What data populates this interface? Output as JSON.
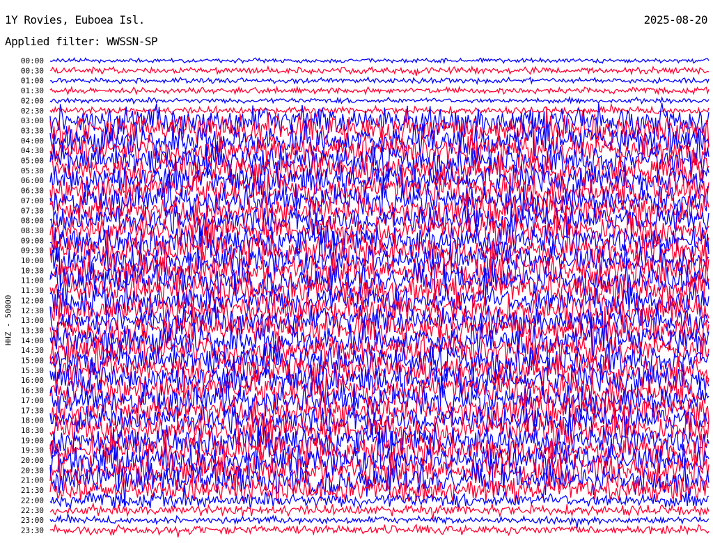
{
  "header": {
    "title": "1Y Rovies, Euboea Isl.",
    "filter": "Applied filter: WWSSN-SP",
    "date": "2025-08-20"
  },
  "chart_data": {
    "type": "line",
    "title": "1Y Rovies, Euboea Isl.",
    "subtitle": "Applied filter: WWSSN-SP",
    "date": "2025-08-20",
    "ylabel": "HHZ - 50000",
    "xlabel": "",
    "row_labels": [
      "00:00",
      "00:30",
      "01:00",
      "01:30",
      "02:00",
      "02:30",
      "03:00",
      "03:30",
      "04:00",
      "04:30",
      "05:00",
      "05:30",
      "06:00",
      "06:30",
      "07:00",
      "07:30",
      "08:00",
      "08:30",
      "09:00",
      "09:30",
      "10:00",
      "10:30",
      "11:00",
      "11:30",
      "12:00",
      "12:30",
      "13:00",
      "13:30",
      "14:00",
      "14:30",
      "15:00",
      "15:30",
      "16:00",
      "16:30",
      "17:00",
      "17:30",
      "18:00",
      "18:30",
      "19:00",
      "19:30",
      "20:00",
      "20:30",
      "21:00",
      "21:30",
      "22:00",
      "22:30",
      "23:00",
      "23:30"
    ],
    "row_amplitude_level": [
      0.15,
      0.22,
      0.18,
      0.2,
      0.18,
      0.25,
      1.0,
      1.0,
      1.0,
      1.0,
      1.0,
      1.0,
      1.0,
      1.0,
      1.0,
      1.0,
      1.0,
      1.0,
      1.0,
      1.0,
      1.0,
      1.0,
      1.0,
      1.0,
      1.0,
      1.0,
      1.0,
      1.0,
      1.0,
      1.0,
      1.0,
      1.0,
      1.0,
      1.0,
      1.0,
      1.0,
      1.0,
      1.0,
      1.0,
      1.0,
      1.0,
      1.0,
      1.0,
      0.8,
      0.5,
      0.35,
      0.25,
      0.3
    ],
    "trace_colors": [
      "#0000ff",
      "#ff0030"
    ],
    "x_range_minutes": [
      0,
      30
    ]
  }
}
